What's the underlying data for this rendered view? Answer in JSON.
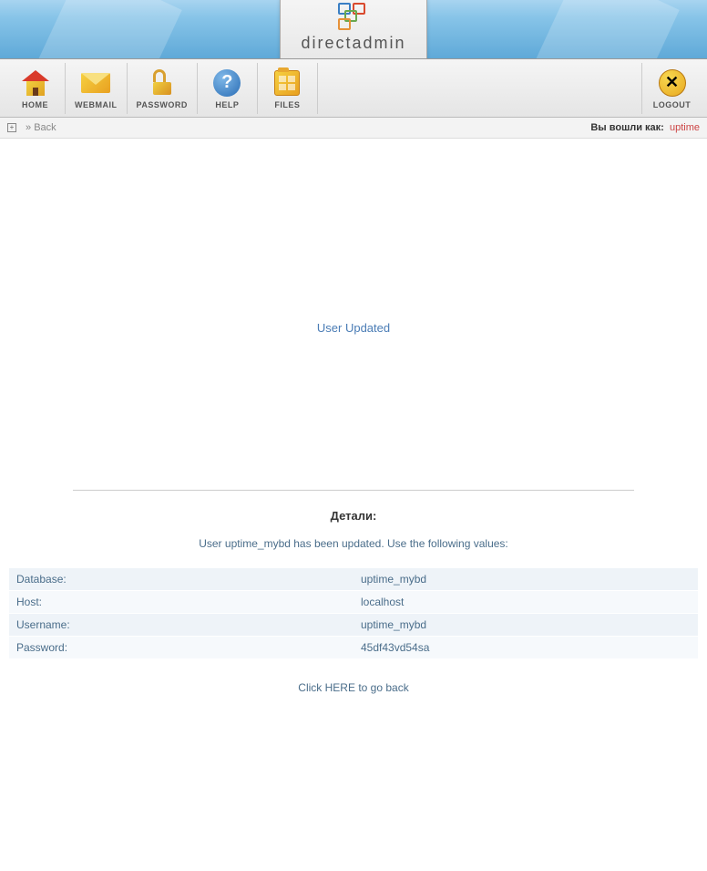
{
  "brand": "directadmin",
  "toolbar": {
    "home": "HOME",
    "webmail": "WEBMAIL",
    "password": "PASSWORD",
    "help": "HELP",
    "files": "FILES",
    "logout": "LOGOUT"
  },
  "breadcrumb": {
    "back": "Back",
    "login_prefix": "Вы вошли как:",
    "username": "uptime"
  },
  "status": "User Updated",
  "details": {
    "title": "Детали:",
    "message": "User uptime_mybd has been updated. Use the following values:",
    "rows": [
      {
        "label": "Database:",
        "value": "uptime_mybd"
      },
      {
        "label": "Host:",
        "value": "localhost"
      },
      {
        "label": "Username:",
        "value": "uptime_mybd"
      },
      {
        "label": "Password:",
        "value": "45df43vd54sa"
      }
    ]
  },
  "goback": {
    "prefix": "Click ",
    "link": "HERE",
    "suffix": " to go back"
  }
}
